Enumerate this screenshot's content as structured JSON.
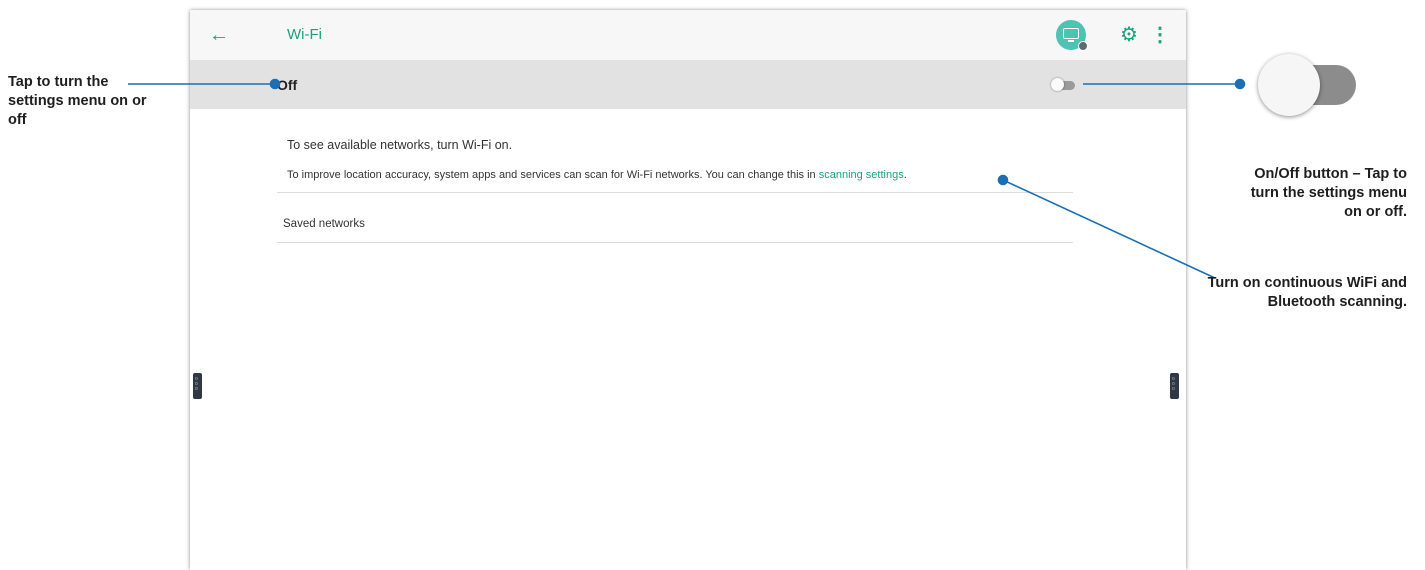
{
  "appbar": {
    "back_icon": "arrow-left-icon",
    "title": "Wi-Fi",
    "cast_icon": "cast-screen-icon",
    "settings_icon": "gear-icon",
    "more_icon": "more-vert-icon",
    "accent_color": "#1aa37a"
  },
  "master_switch": {
    "label": "Off",
    "state": "off"
  },
  "content": {
    "message_primary": "To see available networks, turn Wi-Fi on.",
    "message_secondary_prefix": "To improve location accuracy, system apps and services can scan for Wi-Fi networks. You can change this in ",
    "scanning_link": "scanning settings",
    "message_secondary_suffix": ".",
    "saved_networks_label": "Saved networks"
  },
  "side_handles": {
    "label": "ooo"
  },
  "annotations": {
    "left": "Tap to turn the settings menu on or off",
    "right_toggle": "On/Off button – Tap to turn the settings menu on or off.",
    "right_scanning": "Turn on continuous WiFi and Bluetooth scanning.",
    "toggle_state": "off",
    "leader_color": "#1a6fb5"
  }
}
